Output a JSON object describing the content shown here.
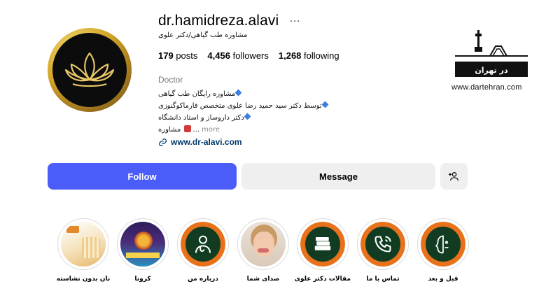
{
  "profile": {
    "username": "dr.hamidreza.alavi",
    "more_icon": "…",
    "full_name": "مشاوره طب گیاهی/دکتر علوی",
    "category": "Doctor",
    "bio_line1": "مشاوره رایگان طب گیاهی",
    "bio_line2": "توسط دکتر سید حمید رضا علوی متخصص فارماکوگنوزی",
    "bio_line3": "دکتر داروساز و استاد دانشگاه",
    "bio_line4": "مشاوره",
    "bio_ellipsis": "...",
    "bio_more": "more",
    "link": "www.dr-alavi.com"
  },
  "stats": {
    "posts_count": "179",
    "posts_label": "posts",
    "followers_count": "4,456",
    "followers_label": "followers",
    "following_count": "1,268",
    "following_label": "following"
  },
  "actions": {
    "follow_label": "Follow",
    "message_label": "Message",
    "add_user_icon": "add-user-icon"
  },
  "logo": {
    "text": "در تهران",
    "url": "www.dartehran.com"
  },
  "highlights": [
    {
      "label": "نان بدون نشاسته"
    },
    {
      "label": "کرونا"
    },
    {
      "label": "درباره من"
    },
    {
      "label": "صدای شما"
    },
    {
      "label": "مقالات دکتر علوی"
    },
    {
      "label": "تماس با ما"
    },
    {
      "label": "قبل و بعد"
    }
  ],
  "colors": {
    "follow_bg": "#4a5df9",
    "link": "#00376b",
    "highlight_orange": "#e8721c",
    "highlight_green": "#123c22",
    "avatar_gold": "#d4a62a"
  }
}
